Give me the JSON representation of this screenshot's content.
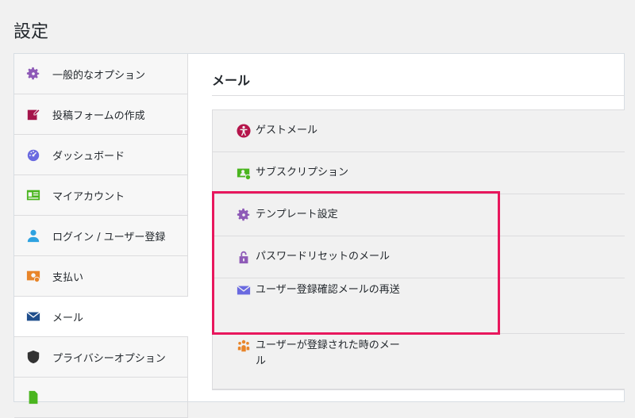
{
  "page": {
    "title": "設定"
  },
  "sidebar": {
    "items": [
      {
        "label": "一般的なオプション",
        "icon": "gear-icon"
      },
      {
        "label": "投稿フォームの作成",
        "icon": "edit-form-icon"
      },
      {
        "label": "ダッシュボード",
        "icon": "dashboard-icon"
      },
      {
        "label": "マイアカウント",
        "icon": "id-card-icon"
      },
      {
        "label": "ログイン / ユーザー登録",
        "icon": "user-icon"
      },
      {
        "label": "支払い",
        "icon": "payment-icon"
      },
      {
        "label": "メール",
        "icon": "envelope-icon",
        "active": true
      },
      {
        "label": "プライバシーオプション",
        "icon": "shield-icon"
      },
      {
        "label": "",
        "icon": "document-icon"
      }
    ]
  },
  "main": {
    "title": "メール",
    "mail_items": [
      {
        "label": "ゲストメール",
        "icon": "accessibility-icon",
        "color": "#b5154b"
      },
      {
        "label": "サブスクリプション",
        "icon": "subscription-icon",
        "color": "#4ab51f"
      },
      {
        "label": "テンプレート設定",
        "icon": "gear-icon",
        "color": "#8e5ab7"
      },
      {
        "label": "パスワードリセットのメール",
        "icon": "lock-icon",
        "color": "#8e5ab7"
      },
      {
        "label": "ユーザー登録確認メールの再送",
        "icon": "envelope-icon",
        "color": "#6a6ae0"
      },
      {
        "label": "ユーザーが登録された時のメール",
        "icon": "group-icon",
        "color": "#e8852a"
      }
    ]
  },
  "colors": {
    "highlight": "#e8175d"
  }
}
